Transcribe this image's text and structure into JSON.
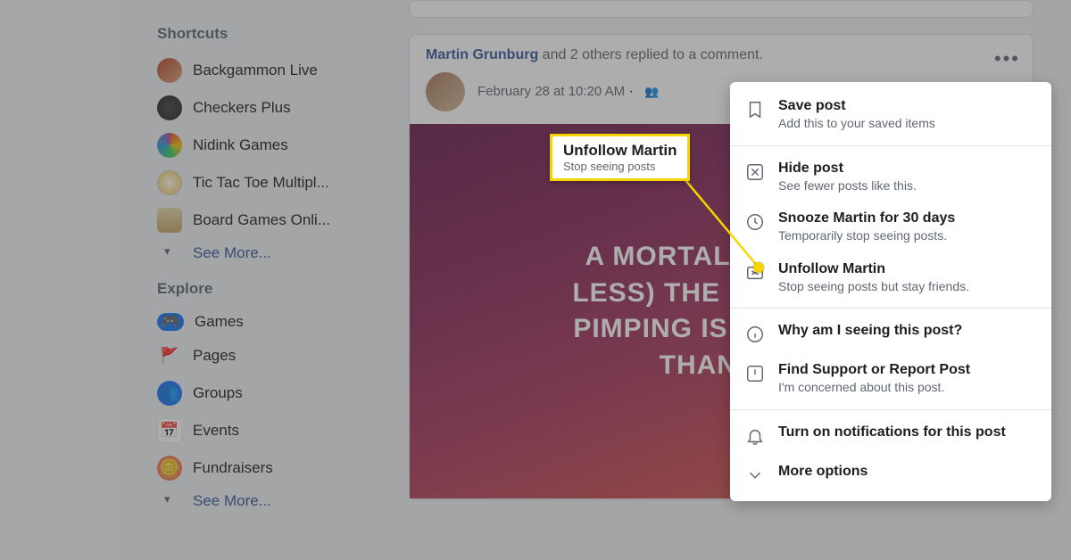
{
  "sidebar": {
    "shortcuts_title": "Shortcuts",
    "explore_title": "Explore",
    "see_more": "See More...",
    "shortcuts": [
      {
        "label": "Backgammon Live",
        "iconClass": "ic-red ic-round"
      },
      {
        "label": "Checkers Plus",
        "iconClass": "ic-dark ic-round"
      },
      {
        "label": "Nidink Games",
        "iconClass": "ic-multi ic-round"
      },
      {
        "label": "Tic Tac Toe Multipl...",
        "iconClass": "ic-ttt ic-round"
      },
      {
        "label": "Board Games Onli...",
        "iconClass": "ic-board"
      }
    ],
    "explore": [
      {
        "label": "Games",
        "iconClass": "ic-games",
        "glyph": "🎮"
      },
      {
        "label": "Pages",
        "iconClass": "ic-pages",
        "glyph": "🚩"
      },
      {
        "label": "Groups",
        "iconClass": "ic-groups ic-round",
        "glyph": "👥"
      },
      {
        "label": "Events",
        "iconClass": "ic-events",
        "glyph": "📅"
      },
      {
        "label": "Fundraisers",
        "iconClass": "ic-fund ic-round",
        "glyph": "🪙"
      }
    ]
  },
  "post": {
    "reply_name": "Martin Grunburg",
    "reply_rest": " and 2 others replied to a comment.",
    "timestamp": "February 28 at 10:20 AM",
    "privacy_glyph": "👥",
    "dots": "•••",
    "image_text": "A MORTALITY RATE\nLESS) THE \"PANDEMI\nPIMPING IS MORE DA\nTHAN TH"
  },
  "menu": {
    "items": [
      {
        "title": "Save post",
        "sub": "Add this to your saved items",
        "icon": "bookmark"
      },
      {
        "title": "Hide post",
        "sub": "See fewer posts like this.",
        "icon": "x-box"
      },
      {
        "title": "Snooze Martin for 30 days",
        "sub": "Temporarily stop seeing posts.",
        "icon": "clock"
      },
      {
        "title": "Unfollow Martin",
        "sub": "Stop seeing posts but stay friends.",
        "icon": "unfollow"
      },
      {
        "title": "Why am I seeing this post?",
        "sub": "",
        "icon": "info"
      },
      {
        "title": "Find Support or Report Post",
        "sub": "I'm concerned about this post.",
        "icon": "alert"
      },
      {
        "title": "Turn on notifications for this post",
        "sub": "",
        "icon": "bell"
      },
      {
        "title": "More options",
        "sub": "",
        "icon": "chevron"
      }
    ]
  },
  "callout": {
    "title": "Unfollow Martin",
    "sub": "Stop seeing posts"
  },
  "colors": {
    "highlight": "#f5d400",
    "link": "#385898"
  }
}
